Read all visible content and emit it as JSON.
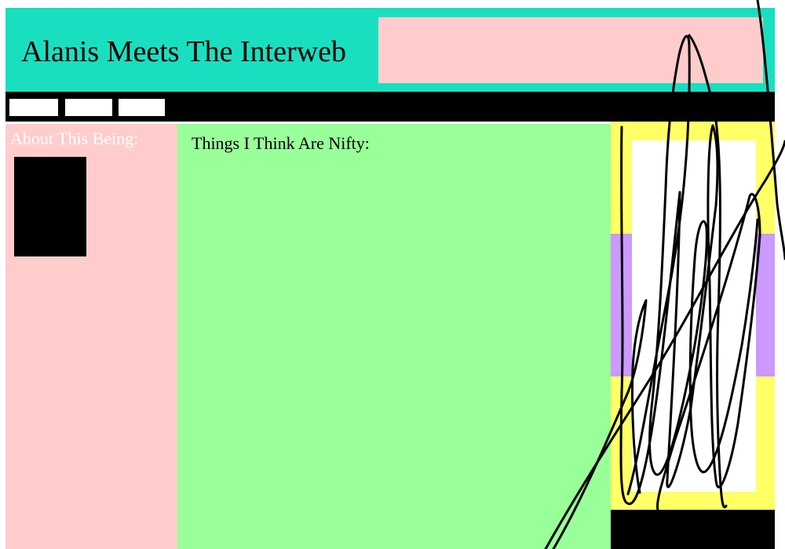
{
  "header": {
    "title": "Alanis Meets The Interweb"
  },
  "nav": {
    "buttons": [
      "",
      "",
      ""
    ]
  },
  "sidebar": {
    "heading": "About This Being:"
  },
  "content": {
    "heading": "Things I Think Are Nifty:"
  },
  "colors": {
    "header_bg": "#19dfc0",
    "banner_bg": "#ffcccc",
    "nav_bg": "#000000",
    "sidebar_bg": "#ffcccc",
    "content_bg": "#99ff99",
    "right_panel_yellow": "#ffff66",
    "right_panel_purple": "#cc99ff"
  }
}
